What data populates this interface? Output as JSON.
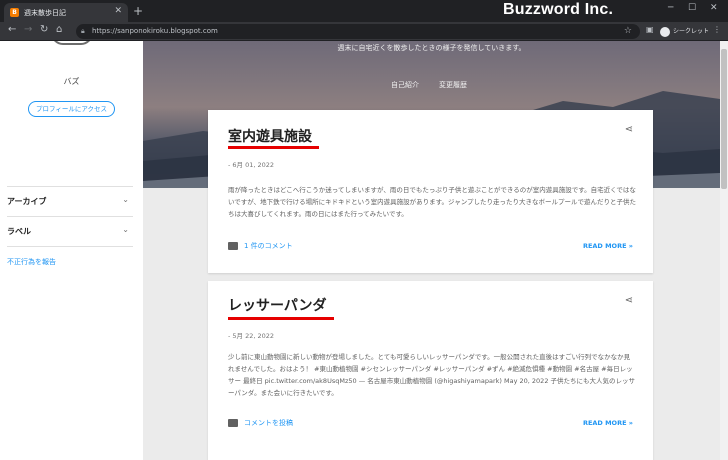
{
  "browser": {
    "tab_title": "週末散歩日記",
    "tab_favicon_letter": "B",
    "url": "https://sanponokiroku.blogspot.com",
    "profile_label": "シークレット",
    "brand_overlay": "Buzzword Inc."
  },
  "sidebar": {
    "profile_name": "バズ",
    "profile_button": "プロフィールにアクセス",
    "archive_label": "アーカイブ",
    "labels_label": "ラベル",
    "report_link": "不正行為を報告"
  },
  "hero": {
    "description": "週末に自宅近くを散歩したときの様子を発信していきます。",
    "links": [
      "自己紹介",
      "変更履歴"
    ]
  },
  "posts": [
    {
      "title": "室内遊具施設",
      "date": "- 6月 01, 2022",
      "body": "雨が降ったときはどこへ行こうか迷ってしまいますが、雨の日でもたっぷり子供と遊ぶことができるのが室内遊具施設です。自宅近くではないですが、地下鉄で行ける場所にキドキドという室内遊具施設があります。ジャンプしたり走ったり大きなボールプールで遊んだりと子供たちは大喜びしてくれます。雨の日にはまた行ってみたいです。",
      "comment": "1 件のコメント",
      "readmore": "READ MORE »"
    },
    {
      "title": "レッサーパンダ",
      "date": "- 5月 22, 2022",
      "body": "少し前に東山動物園に新しい動物が登場しました。とても可愛らしいレッサーパンダです。一般公開された直後はすごい行列でなかなか見れませんでした。おはよう！ #東山動植物園 #シセンレッサーパンダ #レッサーパンダ #ずん #絶滅危惧種 #動物園 #名古屋 #毎日レッサー 最終日 pic.twitter.com/ak8UsqMz50 — 名古屋市東山動植物園 (@higashiyamapark) May 20, 2022 子供たちにも大人気のレッサーパンダ。また会いに行きたいです。",
      "comment": "コメントを投稿",
      "readmore": "READ MORE »"
    }
  ]
}
